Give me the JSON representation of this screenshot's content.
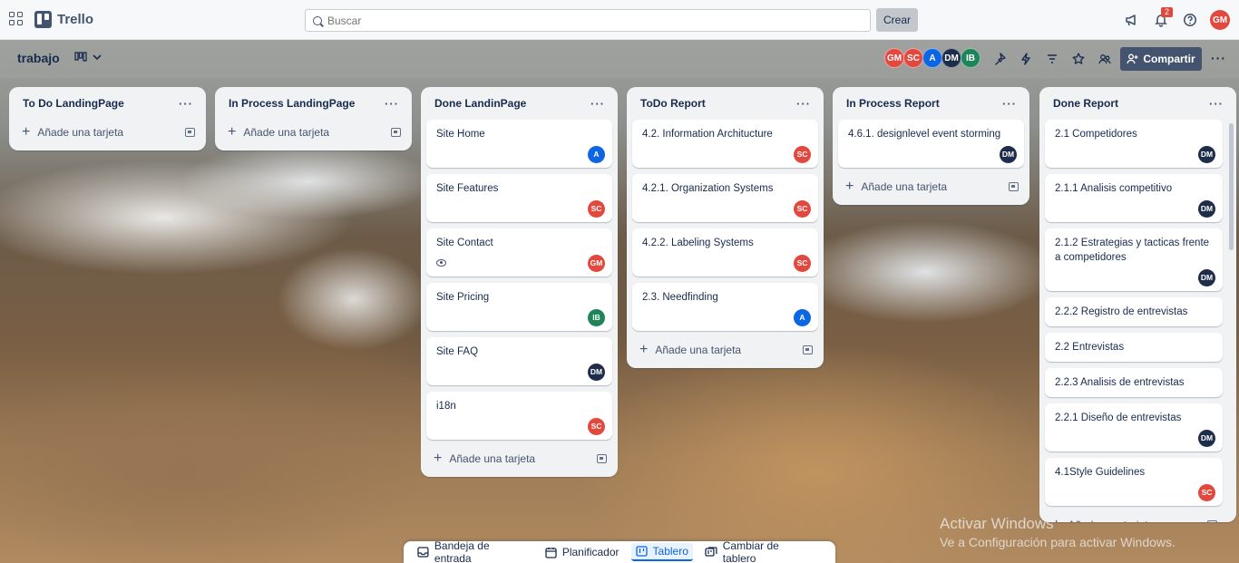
{
  "app": {
    "name": "Trello"
  },
  "search": {
    "placeholder": "Buscar"
  },
  "create_label": "Crear",
  "notifications_count": "2",
  "current_user": {
    "initials": "GM",
    "color": "#e2483d"
  },
  "board": {
    "title": "trabajo"
  },
  "members": [
    {
      "initials": "GM",
      "color": "#e2483d"
    },
    {
      "initials": "SC",
      "color": "#e2483d"
    },
    {
      "initials": "A",
      "color": "#0c66e4"
    },
    {
      "initials": "DM",
      "color": "#1d2d4a"
    },
    {
      "initials": "IB",
      "color": "#1f845a"
    }
  ],
  "share_label": "Compartir",
  "add_card_label": "Añade una tarjeta",
  "lists": [
    {
      "title": "To Do LandingPage",
      "cards": []
    },
    {
      "title": "In Process LandingPage",
      "cards": []
    },
    {
      "title": "Done LandinPage",
      "cards": [
        {
          "title": "Site Home",
          "member": "A"
        },
        {
          "title": "Site Features",
          "member": "SC"
        },
        {
          "title": "Site Contact",
          "member": "GM",
          "watching": true
        },
        {
          "title": "Site Pricing",
          "member": "IB"
        },
        {
          "title": "Site FAQ",
          "member": "DM"
        },
        {
          "title": "i18n",
          "member": "SC"
        }
      ]
    },
    {
      "title": "ToDo Report",
      "cards": [
        {
          "title": "4.2. Information Architucture",
          "member": "SC"
        },
        {
          "title": "4.2.1. Organization Systems",
          "member": "SC"
        },
        {
          "title": "4.2.2. Labeling Systems",
          "member": "SC"
        },
        {
          "title": "2.3. Needfinding",
          "member": "A"
        }
      ]
    },
    {
      "title": "In Process Report",
      "cards": [
        {
          "title": "4.6.1. designlevel event storming",
          "member": "DM"
        }
      ]
    },
    {
      "title": "Done Report",
      "cards": [
        {
          "title": "2.1 Competidores",
          "member": "DM"
        },
        {
          "title": "2.1.1 Analisis competitivo",
          "member": "DM"
        },
        {
          "title": "2.1.2 Estrategias y tacticas frente a competidores",
          "member": "DM"
        },
        {
          "title": "2.2.2 Registro de entrevistas"
        },
        {
          "title": "2.2 Entrevistas"
        },
        {
          "title": "2.2.3 Analisis de entrevistas"
        },
        {
          "title": "2.2.1 Diseño de entrevistas",
          "member": "DM"
        },
        {
          "title": "4.1Style Guidelines",
          "member": "SC"
        }
      ]
    }
  ],
  "bottom_nav": [
    {
      "label": "Bandeja de entrada",
      "icon": "inbox-icon"
    },
    {
      "label": "Planificador",
      "icon": "calendar-icon"
    },
    {
      "label": "Tablero",
      "icon": "board-icon",
      "active": true
    },
    {
      "label": "Cambiar de tablero",
      "icon": "switch-board-icon"
    }
  ],
  "watermark": {
    "line1": "Activar Windows",
    "line2": "Ve a Configuración para activar Windows."
  }
}
